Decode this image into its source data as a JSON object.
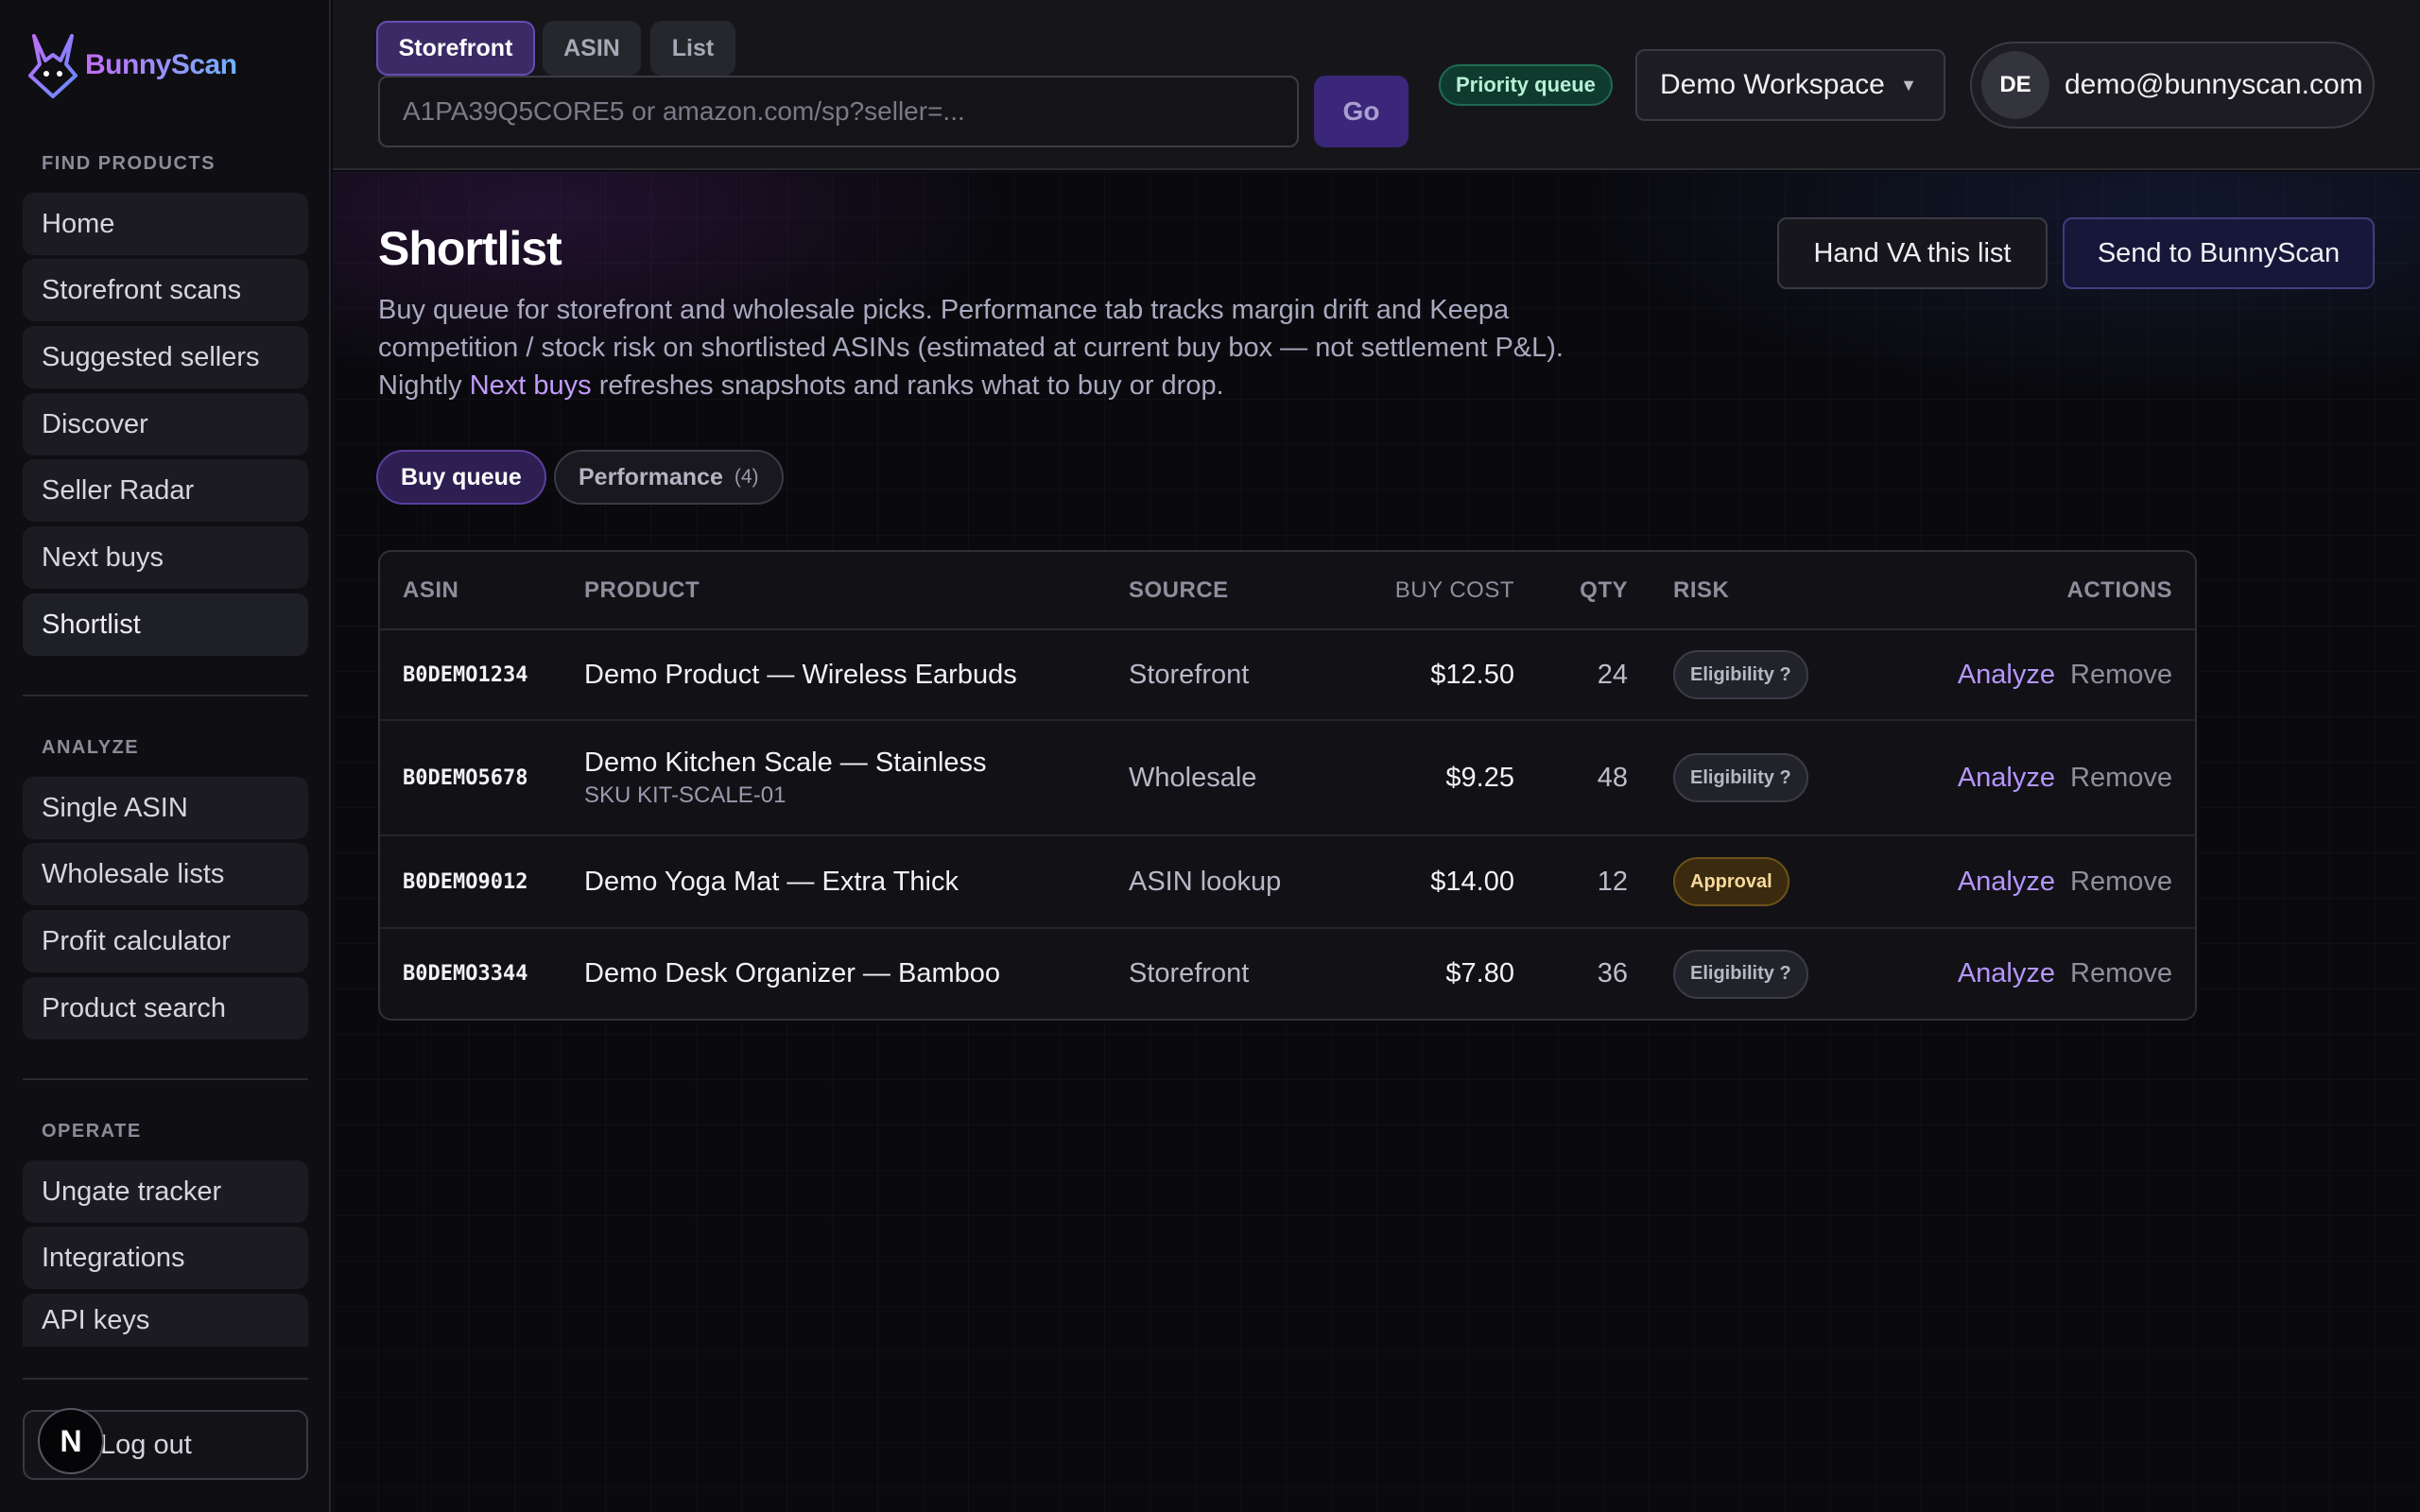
{
  "brand": {
    "name": "BunnyScan",
    "accent": "#7b4fe0"
  },
  "sidebar": {
    "sections": [
      {
        "label": "FIND PRODUCTS",
        "items": [
          "Home",
          "Storefront scans",
          "Suggested sellers",
          "Discover",
          "Seller Radar",
          "Next buys",
          "Shortlist"
        ]
      },
      {
        "label": "ANALYZE",
        "items": [
          "Single ASIN",
          "Wholesale lists",
          "Profit calculator",
          "Product search"
        ]
      },
      {
        "label": "OPERATE",
        "items": [
          "Ungate tracker",
          "Integrations",
          "API keys"
        ]
      }
    ],
    "logout_label": "Log out",
    "n_badge": "N"
  },
  "topbar": {
    "mode_tabs": [
      "Storefront",
      "ASIN",
      "List"
    ],
    "active_mode": "Storefront",
    "search_placeholder": "A1PA39Q5CORE5 or amazon.com/sp?seller=...",
    "go_label": "Go",
    "priority_badge": "Priority queue",
    "workspace": "Demo Workspace",
    "user_initials": "DE",
    "user_email": "demo@bunnyscan.com"
  },
  "page": {
    "title": "Shortlist",
    "description_before": "Buy queue for storefront and wholesale picks. Performance tab tracks margin drift and Keepa competition / stock risk on shortlisted ASINs (estimated at current buy box — not settlement P&L). Nightly ",
    "description_link": "Next buys",
    "description_after": " refreshes snapshots and ranks what to buy or drop.",
    "hand_va_label": "Hand VA this list",
    "send_label": "Send to BunnyScan",
    "subtabs": {
      "buy_queue": "Buy queue",
      "performance": "Performance",
      "performance_count": "(4)"
    }
  },
  "table": {
    "headers": [
      "ASIN",
      "PRODUCT",
      "SOURCE",
      "BUY COST",
      "QTY",
      "RISK",
      "ACTIONS"
    ],
    "rows": [
      {
        "asin": "B0DEMO1234",
        "product": "Demo Product — Wireless Earbuds",
        "sku": "",
        "source": "Storefront",
        "cost": "$12.50",
        "qty": "24",
        "risk": "Eligibility ?",
        "risk_type": "elig"
      },
      {
        "asin": "B0DEMO5678",
        "product": "Demo Kitchen Scale — Stainless",
        "sku": "SKU KIT-SCALE-01",
        "source": "Wholesale",
        "cost": "$9.25",
        "qty": "48",
        "risk": "Eligibility ?",
        "risk_type": "elig"
      },
      {
        "asin": "B0DEMO9012",
        "product": "Demo Yoga Mat — Extra Thick",
        "sku": "",
        "source": "ASIN lookup",
        "cost": "$14.00",
        "qty": "12",
        "risk": "Approval",
        "risk_type": "appr"
      },
      {
        "asin": "B0DEMO3344",
        "product": "Demo Desk Organizer — Bamboo",
        "sku": "",
        "source": "Storefront",
        "cost": "$7.80",
        "qty": "36",
        "risk": "Eligibility ?",
        "risk_type": "elig"
      }
    ],
    "analyze_label": "Analyze",
    "remove_label": "Remove"
  }
}
